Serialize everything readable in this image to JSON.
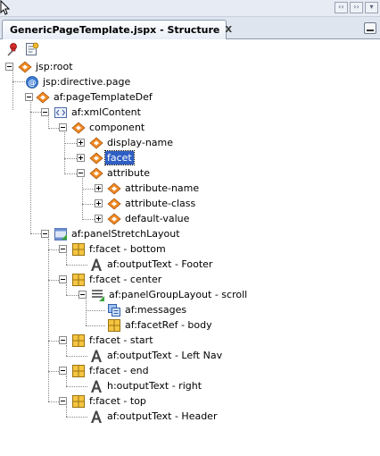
{
  "window": {
    "tab_title": "GenericPageTemplate.jspx - Structure",
    "tab_close_symbol": "X"
  },
  "tree": [
    {
      "label": "jsp:root",
      "icon": "tag-icon"
    },
    {
      "label": "jsp:directive.page",
      "icon": "directive-icon"
    },
    {
      "label": "af:pageTemplateDef",
      "icon": "tag-icon"
    },
    {
      "label": "af:xmlContent",
      "icon": "xml-content-icon"
    },
    {
      "label": "component",
      "icon": "tag-icon"
    },
    {
      "label": "display-name",
      "icon": "tag-icon"
    },
    {
      "label": "facet",
      "icon": "tag-icon",
      "selected": true
    },
    {
      "label": "attribute",
      "icon": "tag-icon"
    },
    {
      "label": "attribute-name",
      "icon": "tag-icon"
    },
    {
      "label": "attribute-class",
      "icon": "tag-icon"
    },
    {
      "label": "default-value",
      "icon": "tag-icon"
    },
    {
      "label": "af:panelStretchLayout",
      "icon": "panel-stretch-layout-icon"
    },
    {
      "label": "f:facet - bottom",
      "icon": "facet-grid-icon"
    },
    {
      "label": "af:outputText - Footer",
      "icon": "output-text-icon"
    },
    {
      "label": "f:facet - center",
      "icon": "facet-grid-icon"
    },
    {
      "label": "af:panelGroupLayout - scroll",
      "icon": "panel-group-layout-icon"
    },
    {
      "label": "af:messages",
      "icon": "messages-icon"
    },
    {
      "label": "af:facetRef - body",
      "icon": "facet-grid-icon"
    },
    {
      "label": "f:facet - start",
      "icon": "facet-grid-icon"
    },
    {
      "label": "af:outputText - Left Nav",
      "icon": "output-text-icon"
    },
    {
      "label": "f:facet - end",
      "icon": "facet-grid-icon"
    },
    {
      "label": "h:outputText - right",
      "icon": "output-text-icon"
    },
    {
      "label": "f:facet - top",
      "icon": "facet-grid-icon"
    },
    {
      "label": "af:outputText - Header",
      "icon": "output-text-icon"
    }
  ]
}
